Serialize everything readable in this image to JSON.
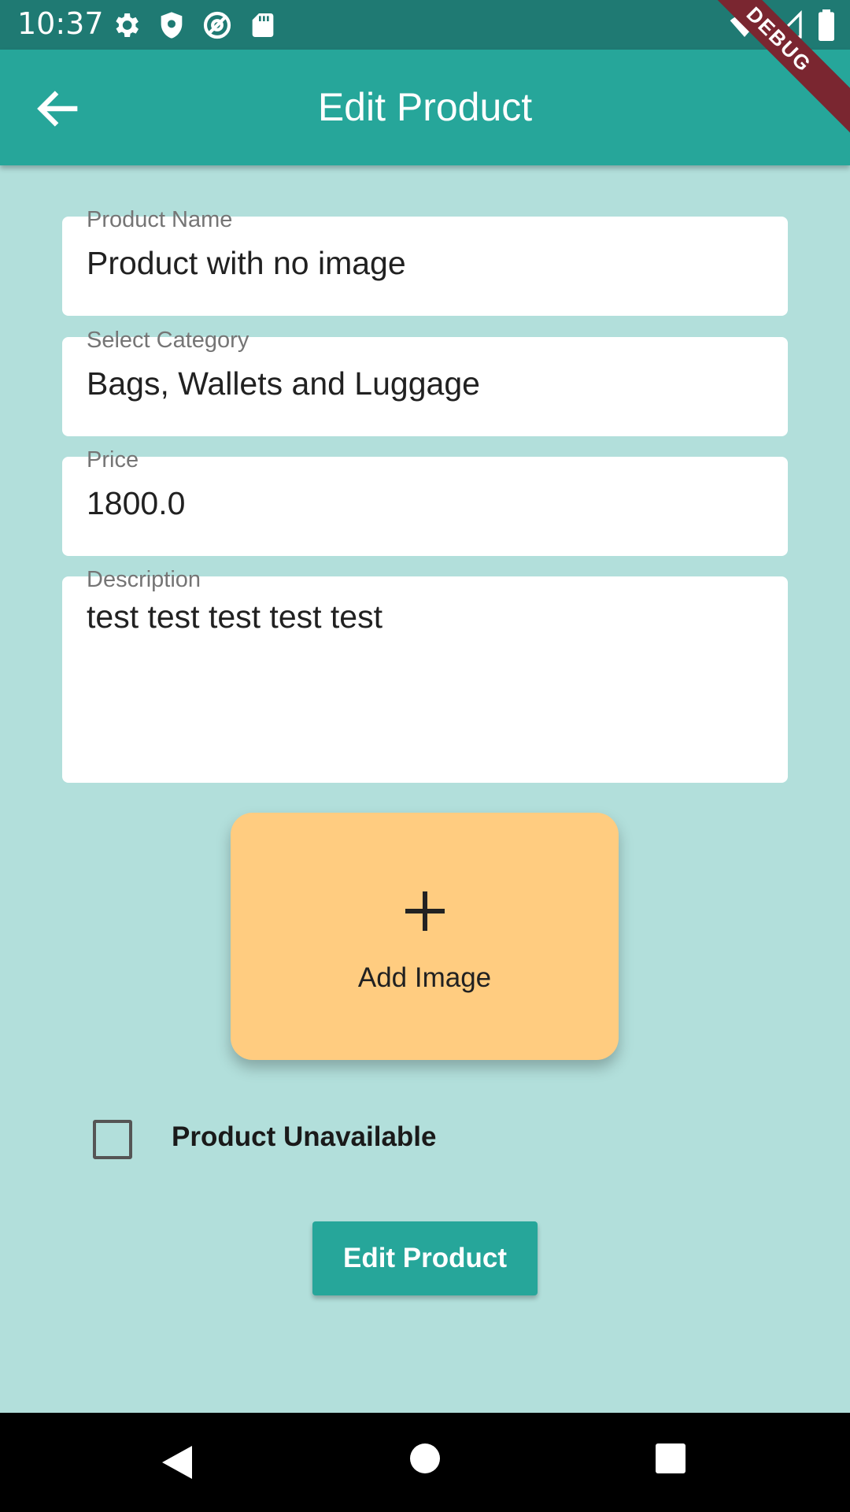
{
  "status_bar": {
    "time": "10:37",
    "icons": [
      "gear-icon",
      "shield-icon",
      "at-sign-icon",
      "sd-card-icon",
      "wifi-icon",
      "signal-icon",
      "battery-icon"
    ],
    "debug_label": "DEBUG"
  },
  "app_bar": {
    "title": "Edit Product",
    "back_icon": "arrow-left-icon"
  },
  "form": {
    "product_name": {
      "label": "Product Name",
      "value": "Product with no image"
    },
    "category": {
      "label": "Select Category",
      "value": "Bags, Wallets and Luggage"
    },
    "price": {
      "label": "Price",
      "value": "1800.0"
    },
    "description": {
      "label": "Description",
      "value": "test test test test test"
    }
  },
  "add_image": {
    "label": "Add Image",
    "icon": "plus-icon"
  },
  "unavailable": {
    "label": "Product Unavailable",
    "checked": false
  },
  "submit": {
    "label": "Edit Product"
  },
  "colors": {
    "primary": "#26a69a",
    "status_bar": "#1f7a73",
    "background": "#b2dfdb",
    "add_image_card": "#ffcc80",
    "debug_ribbon": "#7a2630"
  }
}
